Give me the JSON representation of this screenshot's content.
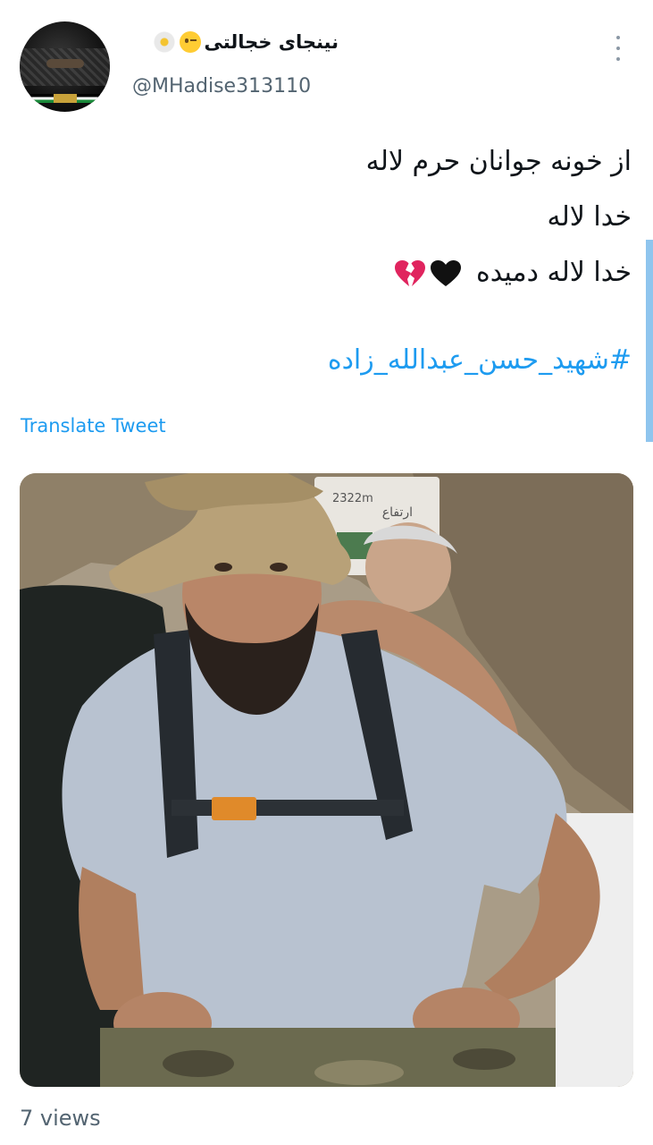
{
  "author": {
    "display_name": "نینجای خجالتی",
    "handle": "@MHadise313110",
    "avatar_icon": "masked-face-avatar",
    "name_emojis": [
      "winking-face-emoji",
      "white-flower-emoji"
    ]
  },
  "tweet": {
    "lines": [
      "از خونه جوانان حرم لاله",
      "خدا لاله",
      "خدا لاله دمیده"
    ],
    "line_emojis": [
      "black-heart-emoji",
      "broken-heart-emoji"
    ],
    "hashtag": "#شهید_حسن_عبدالله_زاده"
  },
  "actions": {
    "translate": "Translate Tweet",
    "more_icon": "more-vertical-icon"
  },
  "media": {
    "type": "photo",
    "sign_text": [
      "2322m",
      "ارتفاع"
    ]
  },
  "stats": {
    "views": "7 views"
  },
  "colors": {
    "link": "#1d9bf0",
    "secondary_text": "#536471",
    "primary_text": "#0f1419",
    "background": "#ffffff"
  }
}
